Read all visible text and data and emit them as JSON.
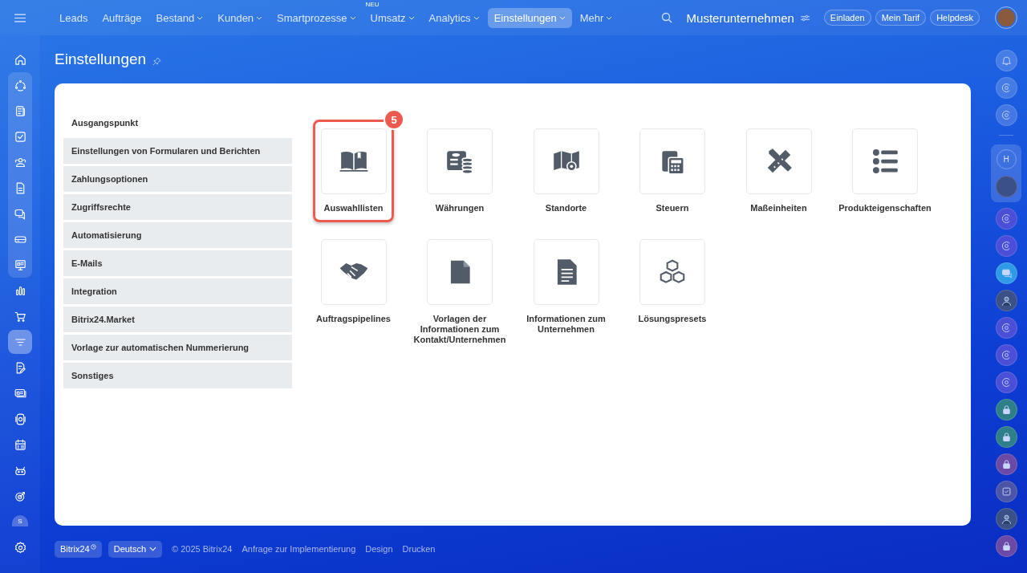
{
  "top_nav": {
    "items": [
      {
        "label": "Leads",
        "dropdown": false,
        "selected": false
      },
      {
        "label": "Aufträge",
        "dropdown": false,
        "selected": false
      },
      {
        "label": "Bestand",
        "dropdown": true,
        "selected": false
      },
      {
        "label": "Kunden",
        "dropdown": true,
        "selected": false
      },
      {
        "label": "Smartprozesse",
        "dropdown": true,
        "selected": false
      },
      {
        "label": "Umsatz",
        "dropdown": true,
        "selected": false,
        "badge": "NEU"
      },
      {
        "label": "Analytics",
        "dropdown": true,
        "selected": false
      },
      {
        "label": "Einstellungen",
        "dropdown": true,
        "selected": true
      },
      {
        "label": "Mehr",
        "dropdown": true,
        "selected": false
      }
    ],
    "company": "Musterunternehmen",
    "buttons": [
      "Einladen",
      "Mein Tarif",
      "Helpdesk"
    ]
  },
  "left_sidebar": {
    "items": [
      {
        "selected": false
      },
      {
        "selected": false
      },
      {
        "selected": false
      },
      {
        "selected": false
      },
      {
        "selected": false
      },
      {
        "selected": false
      },
      {
        "selected": false
      },
      {
        "selected": false
      },
      {
        "selected": false
      },
      {
        "selected": false
      },
      {
        "selected": false
      },
      {
        "selected": true
      },
      {
        "selected": false
      },
      {
        "selected": false
      },
      {
        "selected": false
      },
      {
        "selected": false
      },
      {
        "selected": false
      },
      {
        "selected": false
      }
    ],
    "user_initial": "S"
  },
  "right_sidebar": {
    "contact_initial": "H"
  },
  "page_title": "Einstellungen",
  "settings_menu": {
    "items": [
      {
        "label": "Ausgangspunkt",
        "selected": true
      },
      {
        "label": "Einstellungen von Formularen und Berichten",
        "selected": false
      },
      {
        "label": "Zahlungsoptionen",
        "selected": false
      },
      {
        "label": "Zugriffsrechte",
        "selected": false
      },
      {
        "label": "Automatisierung",
        "selected": false
      },
      {
        "label": "E-Mails",
        "selected": false
      },
      {
        "label": "Integration",
        "selected": false
      },
      {
        "label": "Bitrix24.Market",
        "selected": false
      },
      {
        "label": "Vorlage zur automatischen Nummerierung",
        "selected": false
      },
      {
        "label": "Sonstiges",
        "selected": false
      }
    ]
  },
  "tiles": [
    {
      "label": "Auswahllisten",
      "highlighted": true,
      "step": "5"
    },
    {
      "label": "Währungen",
      "highlighted": false
    },
    {
      "label": "Standorte",
      "highlighted": false
    },
    {
      "label": "Steuern",
      "highlighted": false
    },
    {
      "label": "Maßeinheiten",
      "highlighted": false
    },
    {
      "label": "Produkteigenschaften",
      "highlighted": false
    },
    {
      "label": "Auftragspipelines",
      "highlighted": false
    },
    {
      "label": "Vorlagen der Informationen zum Kontakt/Unternehmen",
      "highlighted": false
    },
    {
      "label": "Informationen zum Unternehmen",
      "highlighted": false
    },
    {
      "label": "Lösungspresets",
      "highlighted": false
    }
  ],
  "footer": {
    "brand": "Bitrix24",
    "language": "Deutsch",
    "copyright": "© 2025 Bitrix24",
    "links": [
      "Anfrage zur Implementierung",
      "Design",
      "Drucken"
    ]
  }
}
